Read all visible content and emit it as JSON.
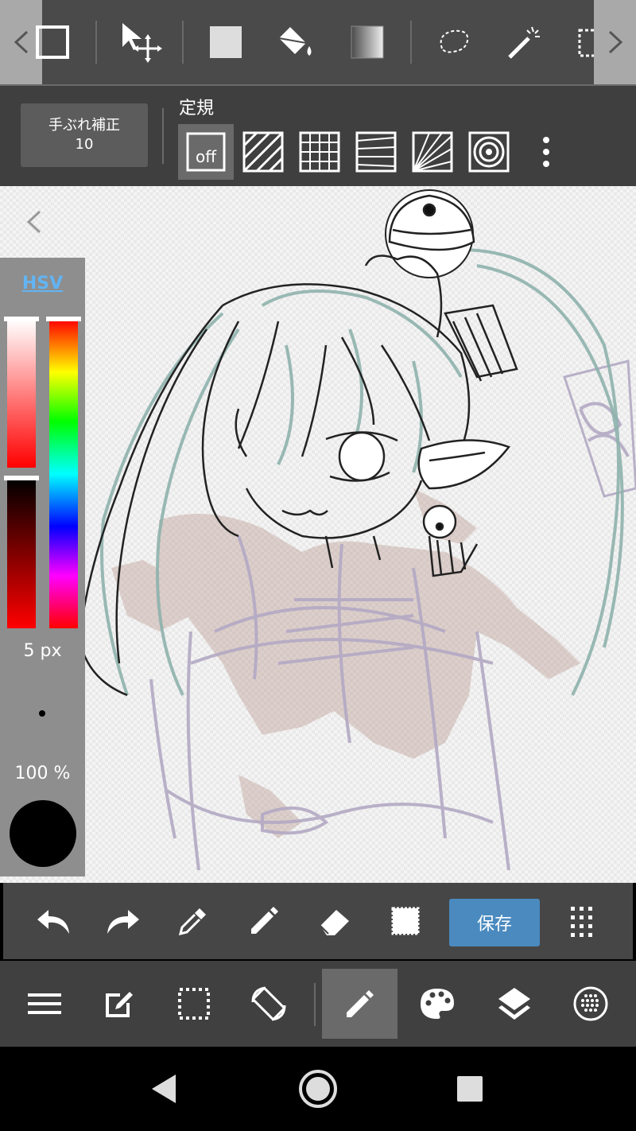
{
  "top_toolbar": {
    "tools": [
      {
        "name": "brush-shape-icon",
        "active": false
      },
      {
        "name": "move-icon"
      },
      {
        "name": "fill-rect-icon"
      },
      {
        "name": "bucket-icon"
      },
      {
        "name": "gradient-icon"
      },
      {
        "name": "lasso-icon"
      },
      {
        "name": "magic-wand-icon"
      },
      {
        "name": "select-pen-icon"
      }
    ]
  },
  "stabilizer": {
    "label": "手ぶれ補正",
    "value": "10"
  },
  "ruler": {
    "title": "定規",
    "off_label": "off",
    "selected": "off"
  },
  "color_panel": {
    "mode_tab": "HSV",
    "brush_size": "5 px",
    "opacity": "100 %",
    "current_color": "#000000"
  },
  "action_bar": {
    "save_label": "保存"
  },
  "main_nav": {
    "active": "brush"
  },
  "colors": {
    "toolbar_bg": "#4a4a4a",
    "ruler_bg": "#3f3f3f",
    "accent": "#4a8abf",
    "hsv_link": "#62b4f3"
  }
}
